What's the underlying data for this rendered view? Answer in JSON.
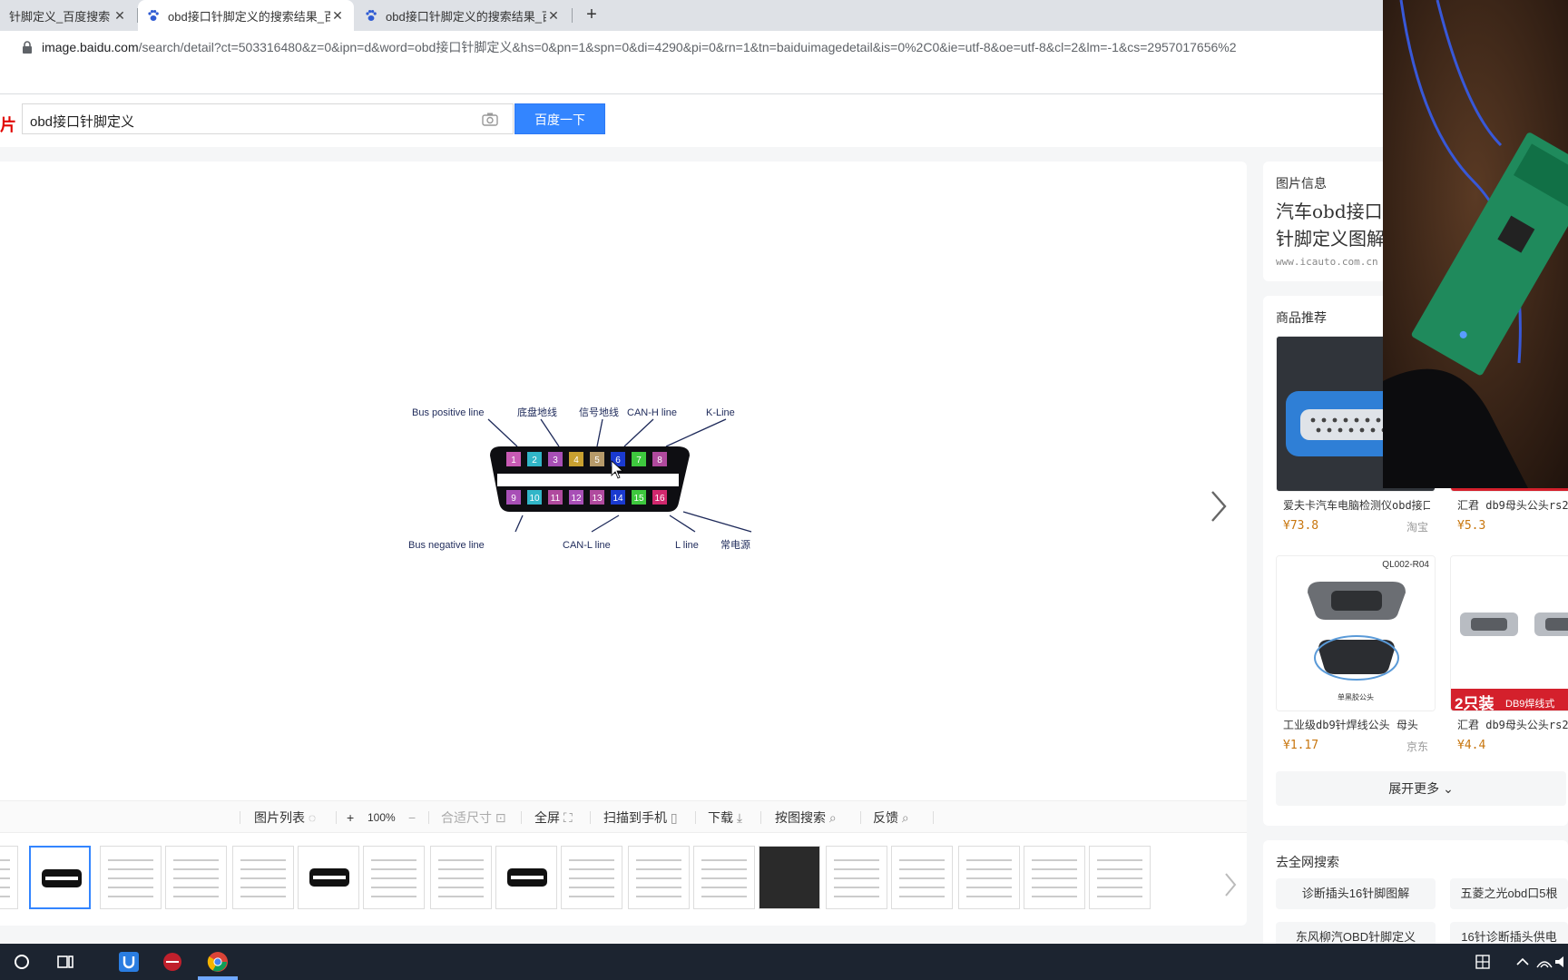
{
  "tabs": [
    {
      "title": "针脚定义_百度搜索",
      "active": false
    },
    {
      "title": "obd接口针脚定义的搜索结果_百",
      "active": true
    },
    {
      "title": "obd接口针脚定义的搜索结果_百",
      "active": false
    }
  ],
  "tab_close": "✕",
  "newtab": "+",
  "address": {
    "host": "image.baidu.com",
    "path": "/search/detail?ct=503316480&z=0&ipn=d&word=obd接口针脚定义&hs=0&pn=1&spn=0&di=4290&pi=0&rn=1&tn=baiduimagedetail&is=0%2C0&ie=utf-8&oe=utf-8&cl=2&lm=-1&cs=2957017656%2"
  },
  "search": {
    "brand": "片",
    "query": "obd接口针脚定义",
    "button": "百度一下"
  },
  "diagram": {
    "labels_top": [
      "Bus positive  line",
      "底盘地线",
      "信号地线",
      "CAN-H line",
      "K-Line"
    ],
    "labels_bottom": [
      "Bus negative  line",
      "CAN-L line",
      "L line",
      "常电源"
    ],
    "pins_top": [
      "1",
      "2",
      "3",
      "4",
      "5",
      "6",
      "7",
      "8"
    ],
    "pins_bottom": [
      "9",
      "10",
      "11",
      "12",
      "13",
      "14",
      "15",
      "16"
    ],
    "pin_colors_top": [
      "#c85ab4",
      "#31b6c8",
      "#a84fb6",
      "#c8a030",
      "#b69a6a",
      "#1a3ad0",
      "#3ec83e",
      "#b04a9e"
    ],
    "pin_colors_bottom": [
      "#a84fb6",
      "#31b6c8",
      "#b04a9e",
      "#a84fb6",
      "#b04a9e",
      "#1a3ad0",
      "#3ec83e",
      "#d2286e"
    ]
  },
  "toolbar": {
    "list": "图片列表",
    "zoom_in": "+",
    "zoom": "100%",
    "zoom_out": "−",
    "fit": "合适尺寸",
    "fullscreen": "全屏",
    "scan": "扫描到手机",
    "download": "下载",
    "search_by_image": "按图搜索",
    "feedback": "反馈"
  },
  "info": {
    "label": "图片信息",
    "title": "汽车obd接口针脚定义图解",
    "source": "www.icauto.com.cn"
  },
  "products": {
    "label": "商品推荐",
    "items": [
      {
        "name": "爱夫卡汽车电脑检测仪obd接口",
        "price": "¥73.8",
        "shop": "淘宝"
      },
      {
        "name": "汇君 db9母头公头rs232",
        "price": "¥5.3",
        "shop": ""
      },
      {
        "name": "工业级db9针焊线公头 母头",
        "price": "¥1.17",
        "shop": "京东"
      },
      {
        "name": "汇君 db9母头公头rs232",
        "price": "¥4.4",
        "shop": ""
      }
    ],
    "tag_model": "QL002-R04",
    "tag_pack": "2只装",
    "tag_pack_sub": "DB9焊线式",
    "tag_caption": "单黑胶公头",
    "expand": "展开更多"
  },
  "web_search": {
    "label": "去全网搜索",
    "items": [
      "诊断插头16针脚图解",
      "五菱之光obd口5根",
      "东风柳汽OBD针脚定义",
      "16针诊断插头供电"
    ]
  },
  "colors": {
    "accent": "#3385ff",
    "price": "#c8760e",
    "taskbar": "#1c2430"
  }
}
